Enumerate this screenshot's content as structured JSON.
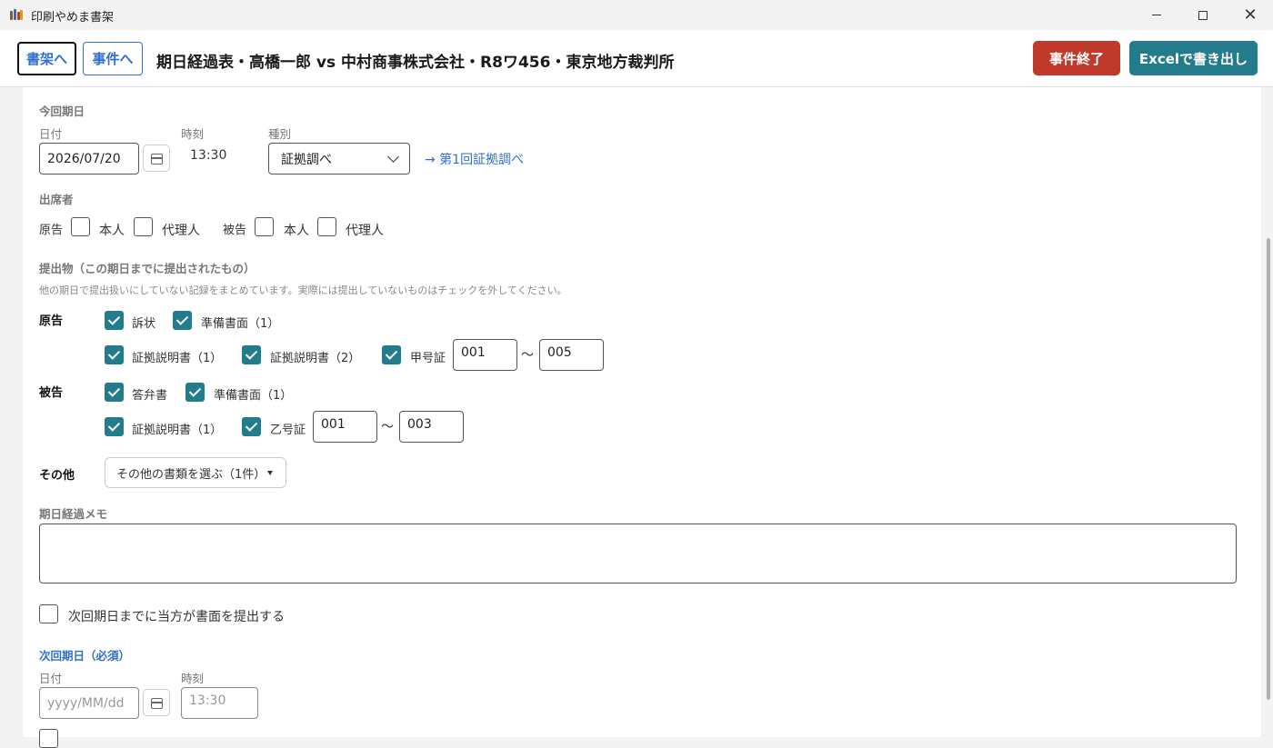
{
  "window": {
    "title": "印刷やめま書架"
  },
  "header": {
    "shelf_button": "書架へ",
    "case_button": "事件へ",
    "title": "期日経過表・高橋一郎 vs 中村商事株式会社・R8ワ456・東京地方裁判所",
    "end_button": "事件終了",
    "excel_button": "Excelで書き出し"
  },
  "current": {
    "section_label": "今回期日",
    "date_label": "日付",
    "date_value": "2026/07/20",
    "time_label": "時刻",
    "time_value": "13:30",
    "type_label": "種別",
    "type_value": "証拠調べ",
    "type_link": "→ 第1回証拠調べ"
  },
  "attendance": {
    "label": "出席者",
    "plaintiff": "原告",
    "defendant": "被告",
    "self": "本人",
    "agent": "代理人"
  },
  "submissions": {
    "label": "提出物（この期日までに提出されたもの）",
    "hint": "他の期日で提出扱いにしていない記録をまとめています。実際には提出していないものはチェックを外してください。",
    "plaintiff_label": "原告",
    "defendant_label": "被告",
    "other_label": "その他",
    "plaintiff_items": [
      "訴状",
      "準備書面（1）",
      "証拠説明書（1）",
      "証拠説明書（2）",
      "甲号証"
    ],
    "plaintiff_evidence_from": "001",
    "plaintiff_evidence_to": "005",
    "defendant_items": [
      "答弁書",
      "準備書面（1）",
      "証拠説明書（1）",
      "乙号証"
    ],
    "defendant_evidence_from": "001",
    "defendant_evidence_to": "003",
    "tilde": "～",
    "other_select": "その他の書類を選ぶ（1件）"
  },
  "memo": {
    "label": "期日経過メモ"
  },
  "next_submit_label": "次回期日までに当方が書面を提出する",
  "next": {
    "section_label": "次回期日（必須）",
    "date_label": "日付",
    "date_placeholder": "yyyy/MM/dd",
    "time_label": "時刻",
    "time_placeholder": "13:30"
  },
  "colors": {
    "accent": "#227c8c",
    "danger": "#c0392b",
    "link": "#2f6fd0"
  }
}
